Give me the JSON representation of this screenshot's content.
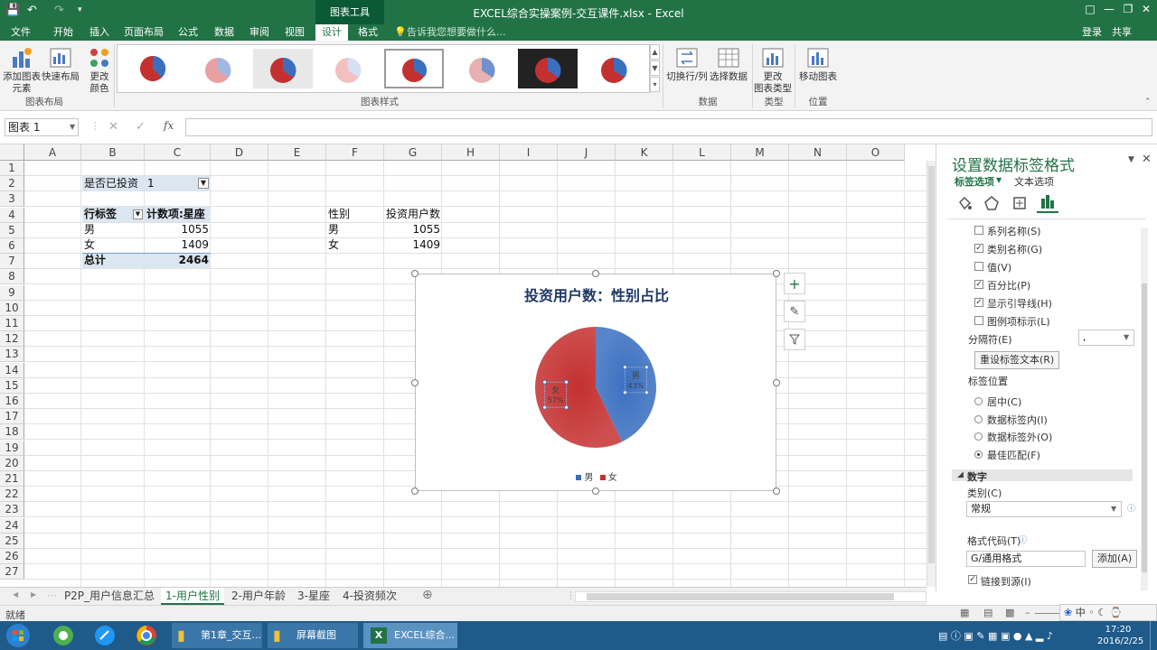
{
  "titlebar": {
    "context_tab": "图表工具",
    "doc_title": "EXCEL综合实操案例-交互课件.xlsx - Excel"
  },
  "ribbon_tabs": [
    "文件",
    "开始",
    "插入",
    "页面布局",
    "公式",
    "数据",
    "审阅",
    "视图",
    "设计",
    "格式"
  ],
  "active_tab": "设计",
  "tell_me": "告诉我您想要做什么...",
  "signin": "登录",
  "share": "共享",
  "ribbon": {
    "add_element": "添加图表",
    "add_element_2": "元素",
    "quick_layout": "快速布局",
    "change_color": "更改",
    "change_color_2": "颜色",
    "group_layout": "图表布局",
    "group_styles": "图表样式",
    "switch_rowcol": "切换行/列",
    "select_data": "选择数据",
    "group_data": "数据",
    "change_type": "更改",
    "change_type_2": "图表类型",
    "group_type": "类型",
    "move_chart": "移动图表",
    "group_location": "位置"
  },
  "formula_bar": {
    "name_box": "图表 1",
    "fx": "fx",
    "value": ""
  },
  "columns": [
    "A",
    "B",
    "C",
    "D",
    "E",
    "F",
    "G",
    "H",
    "I",
    "J",
    "K",
    "L",
    "M",
    "N",
    "O"
  ],
  "rows": [
    "1",
    "2",
    "3",
    "4",
    "5",
    "6",
    "7",
    "8",
    "9",
    "10",
    "11",
    "12",
    "13",
    "14",
    "15",
    "16",
    "17",
    "18",
    "19",
    "20",
    "21",
    "22",
    "23",
    "24",
    "25",
    "26",
    "27"
  ],
  "pivot": {
    "filter_label": "是否已投资",
    "filter_value": "1",
    "row_label": "行标签",
    "count_label": "计数项:星座",
    "rows": [
      {
        "label": "男",
        "value": "1055"
      },
      {
        "label": "女",
        "value": "1409"
      }
    ],
    "total_label": "总计",
    "total_value": "2464"
  },
  "table": {
    "h1": "性别",
    "h2": "投资用户数",
    "rows": [
      {
        "label": "男",
        "value": "1055"
      },
      {
        "label": "女",
        "value": "1409"
      }
    ]
  },
  "chart_data": {
    "type": "pie",
    "title": "投资用户数：性别占比",
    "categories": [
      "男",
      "女"
    ],
    "values": [
      1055,
      1409
    ],
    "labels": [
      {
        "name": "男",
        "pct": "43%"
      },
      {
        "name": "女",
        "pct": "57%"
      }
    ],
    "colors": [
      "#3a6fc0",
      "#c43030"
    ],
    "legend": "bottom"
  },
  "panel": {
    "title": "设置数据标签格式",
    "tab_label_options": "标签选项",
    "tab_text_options": "文本选项",
    "checks": [
      {
        "label": "系列名称(S)",
        "checked": false
      },
      {
        "label": "类别名称(G)",
        "checked": true
      },
      {
        "label": "值(V)",
        "checked": false
      },
      {
        "label": "百分比(P)",
        "checked": true
      },
      {
        "label": "显示引导线(H)",
        "checked": true
      },
      {
        "label": "图例项标示(L)",
        "checked": false
      }
    ],
    "separator_label": "分隔符(E)",
    "separator_value": ",",
    "reset_button": "重设标签文本(R)",
    "position_label": "标签位置",
    "positions": [
      {
        "label": "居中(C)",
        "on": false
      },
      {
        "label": "数据标签内(I)",
        "on": false
      },
      {
        "label": "数据标签外(O)",
        "on": false
      },
      {
        "label": "最佳匹配(F)",
        "on": true
      }
    ],
    "number_section": "数字",
    "category_label": "类别(C)",
    "category_value": "常规",
    "format_code_label": "格式代码(T)",
    "format_code_value": "G/通用格式",
    "add_button": "添加(A)",
    "link_source": "链接到源(I)"
  },
  "sheets": [
    "P2P_用户信息汇总",
    "1-用户性别",
    "2-用户年龄",
    "3-星座",
    "4-投资频次"
  ],
  "active_sheet": "1-用户性别",
  "status": "就绪",
  "taskbar": {
    "items": [
      "第1章_交互...",
      "屏幕截图",
      "EXCEL综合..."
    ],
    "time": "17:20",
    "date": "2016/2/25"
  }
}
